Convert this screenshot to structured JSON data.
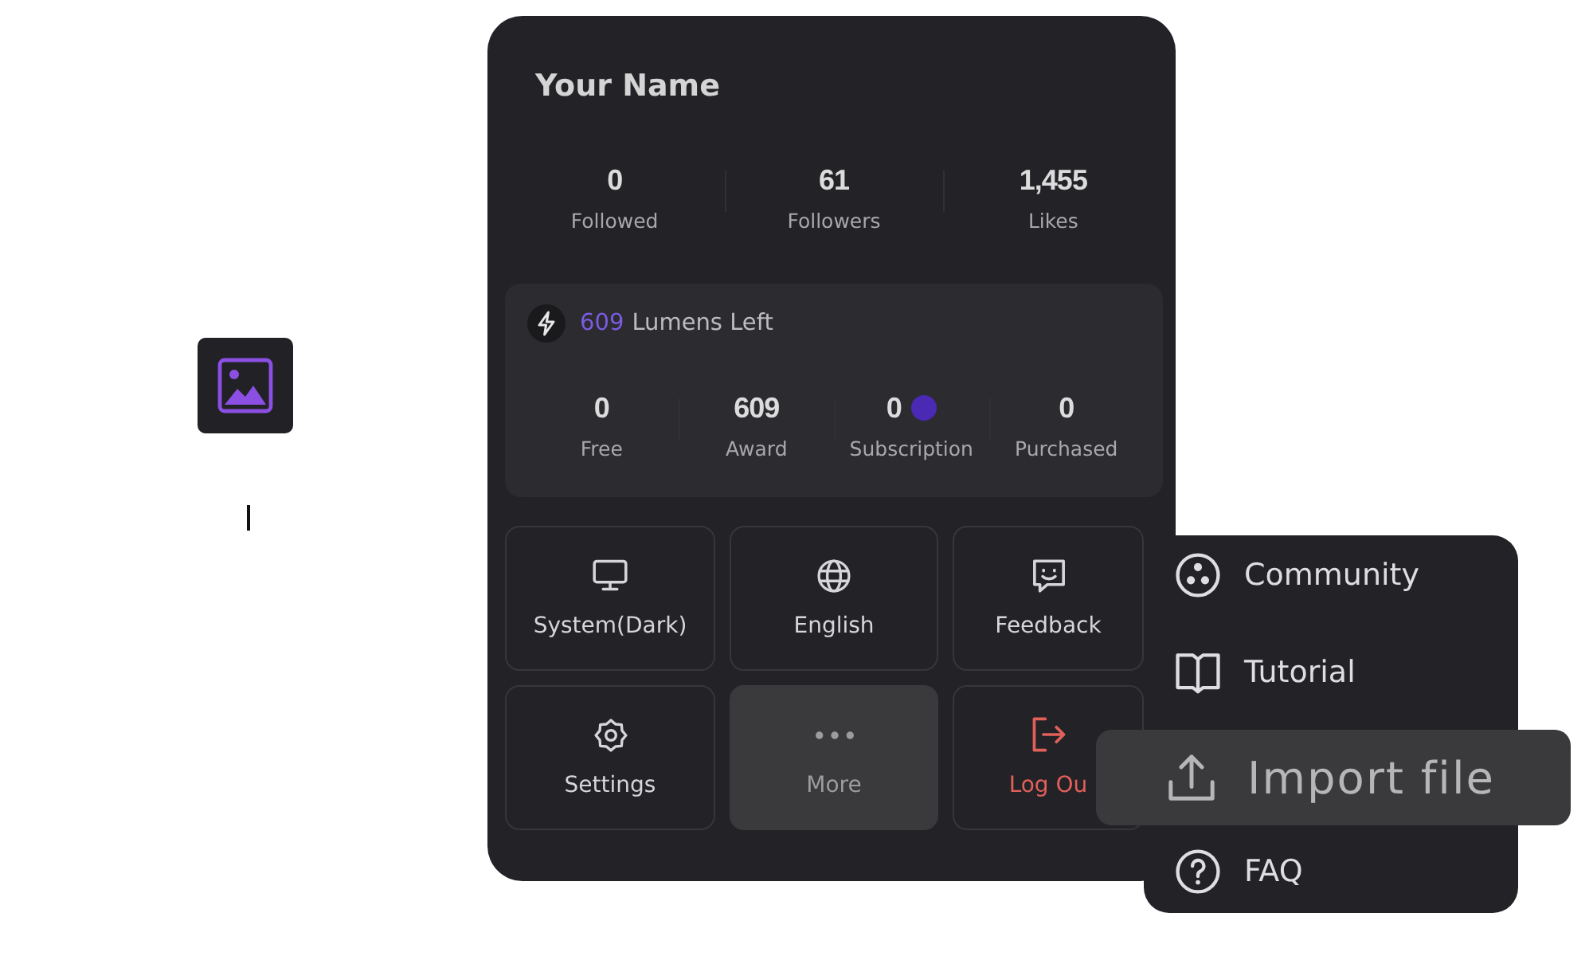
{
  "profile": {
    "name": "Your Name",
    "stats": [
      {
        "value": "0",
        "label": "Followed"
      },
      {
        "value": "61",
        "label": "Followers"
      },
      {
        "value": "1,455",
        "label": "Likes"
      }
    ]
  },
  "lumens": {
    "count": "609",
    "label": "Lumens Left",
    "stats": [
      {
        "value": "0",
        "label": "Free",
        "indicator": false
      },
      {
        "value": "609",
        "label": "Award",
        "indicator": false
      },
      {
        "value": "0",
        "label": "Subscription",
        "indicator": true
      },
      {
        "value": "0",
        "label": "Purchased",
        "indicator": false
      }
    ]
  },
  "actions": [
    {
      "label": "System(Dark)",
      "kind": "normal",
      "selected": false
    },
    {
      "label": "English",
      "kind": "normal",
      "selected": false
    },
    {
      "label": "Feedback",
      "kind": "normal",
      "selected": false
    },
    {
      "label": "Settings",
      "kind": "normal",
      "selected": false
    },
    {
      "label": "More",
      "kind": "normal",
      "selected": true
    },
    {
      "label": "Log Ou",
      "kind": "danger",
      "selected": false
    }
  ],
  "menu": {
    "items": [
      {
        "label": "Community",
        "selected": false
      },
      {
        "label": "Tutorial",
        "selected": false
      },
      {
        "label": "Import file",
        "selected": true
      },
      {
        "label": "FAQ",
        "selected": false
      }
    ]
  }
}
